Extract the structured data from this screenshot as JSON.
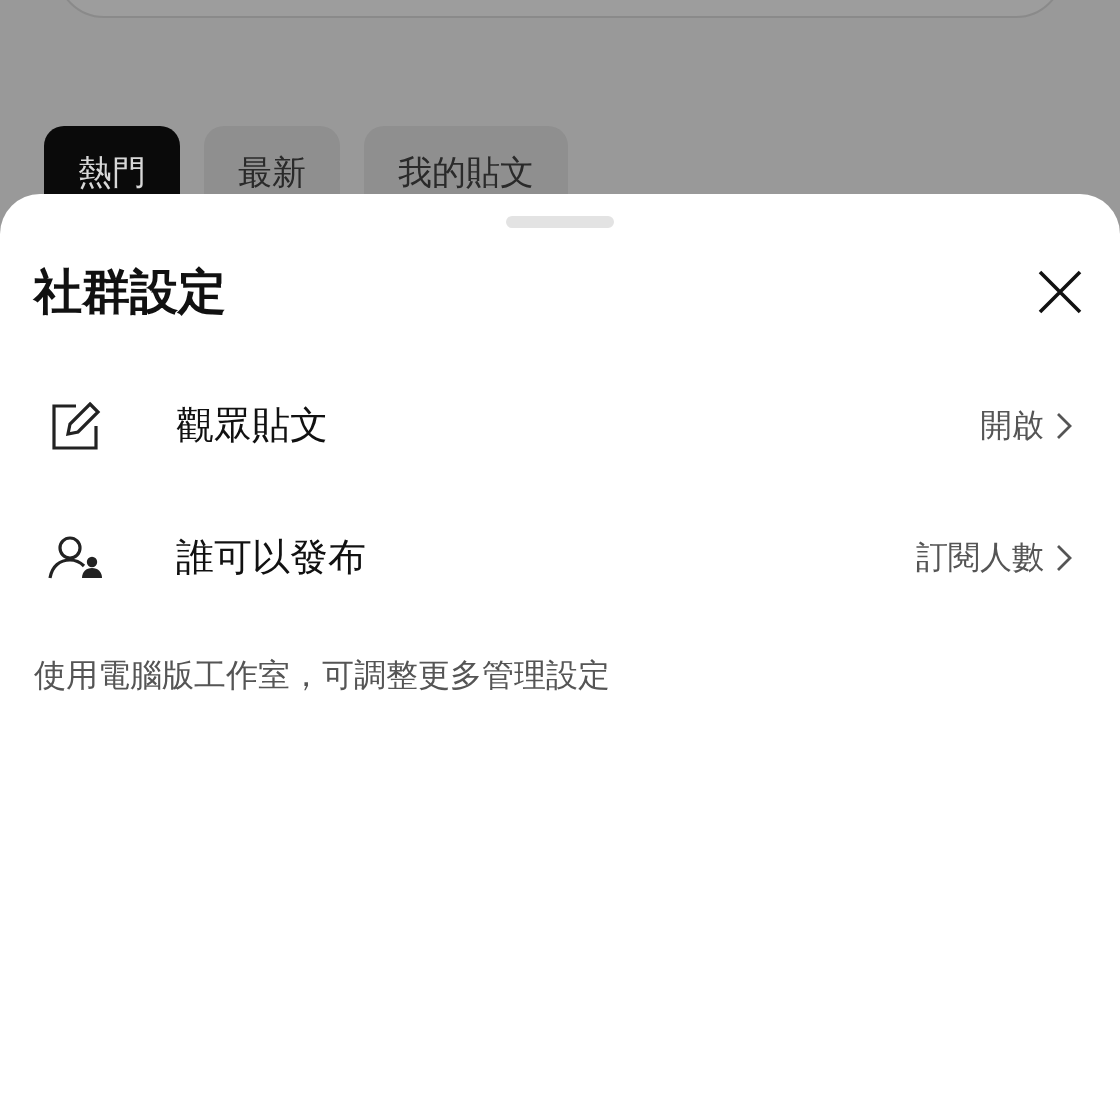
{
  "tabs": [
    {
      "label": "熱門",
      "selected": true
    },
    {
      "label": "最新",
      "selected": false
    },
    {
      "label": "我的貼文",
      "selected": false
    }
  ],
  "sheet": {
    "title": "社群設定",
    "rows": [
      {
        "kind": "edit",
        "label": "觀眾貼文",
        "value": "開啟"
      },
      {
        "kind": "people",
        "label": "誰可以發布",
        "value": "訂閱人數"
      }
    ],
    "note": "使用電腦版工作室，可調整更多管理設定"
  }
}
